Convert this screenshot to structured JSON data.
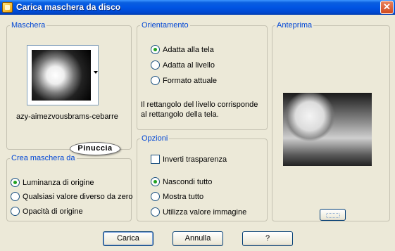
{
  "window": {
    "title": "Carica maschera da disco",
    "close_glyph": "✕"
  },
  "maschera": {
    "legend": "Maschera",
    "mask_name": "azy-aimezvousbrams-cebarre"
  },
  "watermark": "Pinuccia",
  "crea_maschera": {
    "legend": "Crea maschera da",
    "options": [
      "Luminanza di origine",
      "Qualsiasi valore diverso da zero",
      "Opacità di origine"
    ],
    "selected": "Luminanza di origine"
  },
  "orientamento": {
    "legend": "Orientamento",
    "options": [
      "Adatta alla tela",
      "Adatta al livello",
      "Formato attuale"
    ],
    "selected": "Adatta alla tela",
    "description": "Il rettangolo del livello corrisponde al rettangolo della tela."
  },
  "opzioni": {
    "legend": "Opzioni",
    "invert_label": "Inverti trasparenza",
    "invert_checked": false,
    "options": [
      "Nascondi tutto",
      "Mostra tutto",
      "Utilizza valore immagine"
    ],
    "selected": "Nascondi tutto"
  },
  "anteprima": {
    "legend": "Anteprima"
  },
  "buttons": {
    "ok": "Carica",
    "cancel": "Annulla",
    "help": "?"
  },
  "icons": {
    "title": "mask-app-icon",
    "close": "close-icon",
    "dropdown": "chevron-down-icon",
    "preview_toggle": "preview-icon"
  }
}
